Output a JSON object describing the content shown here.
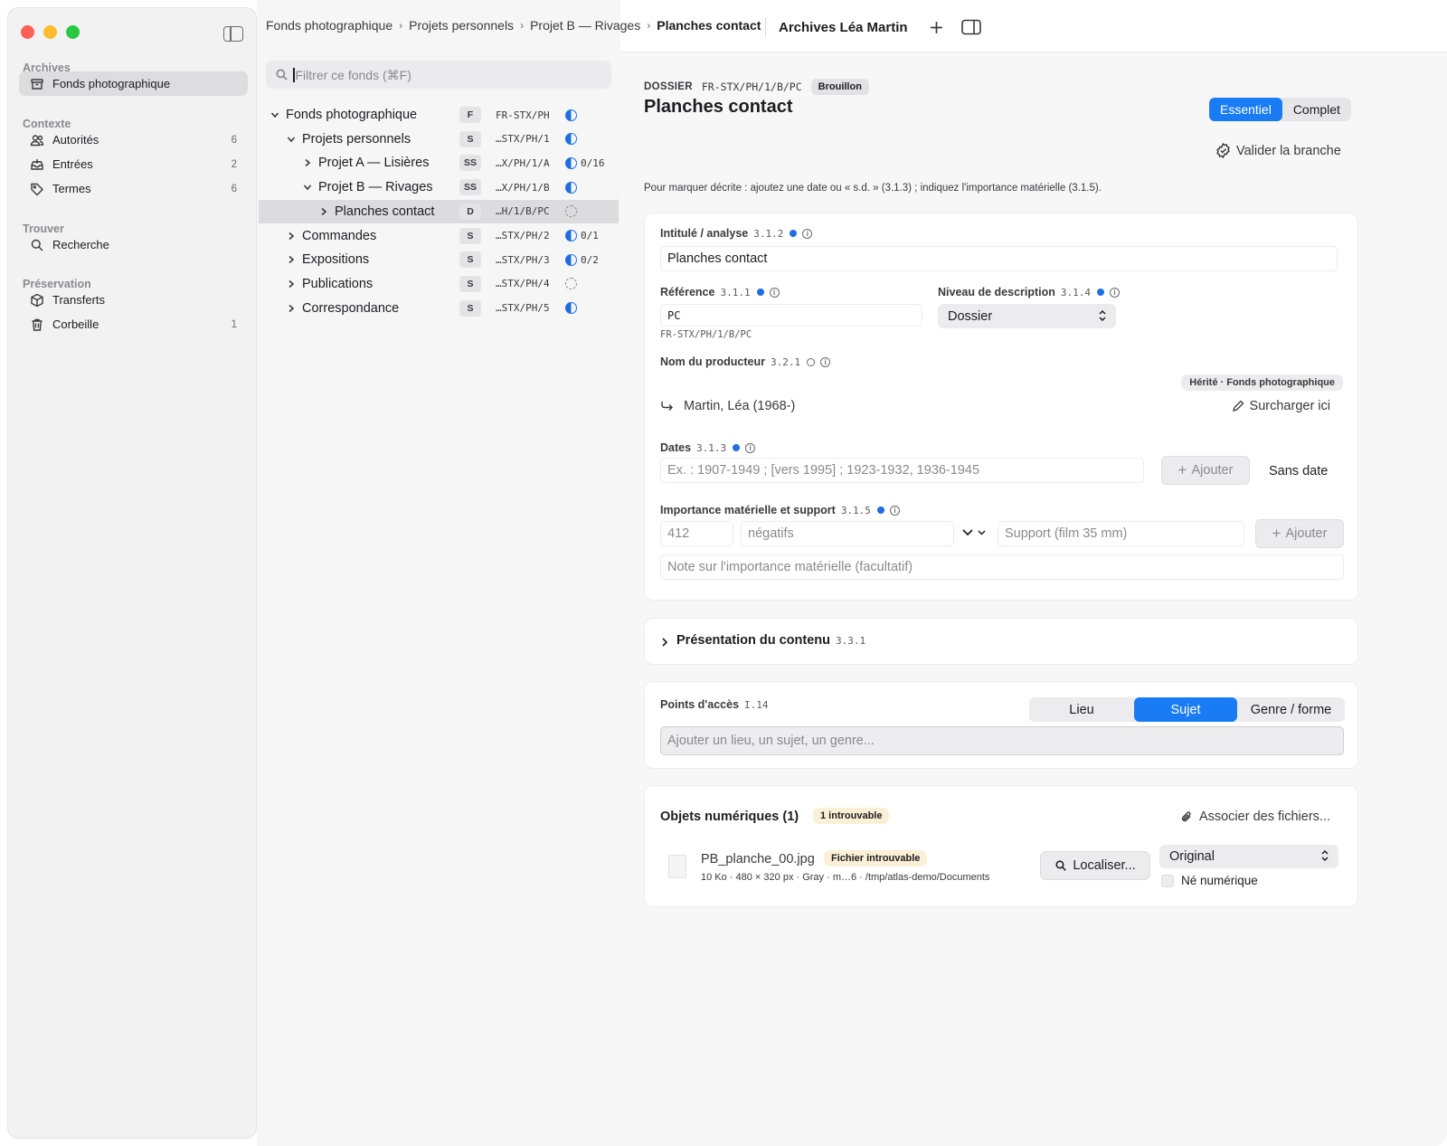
{
  "sidebar": {
    "sections": [
      {
        "title": "Archives",
        "items": [
          {
            "label": "Fonds photographique",
            "count": "",
            "icon": "archive-box-icon",
            "active": true
          }
        ]
      },
      {
        "title": "Contexte",
        "items": [
          {
            "label": "Autorités",
            "count": "6",
            "icon": "people-icon"
          },
          {
            "label": "Entrées",
            "count": "2",
            "icon": "inbox-tray-icon"
          },
          {
            "label": "Termes",
            "count": "6",
            "icon": "tag-icon"
          }
        ]
      },
      {
        "title": "Trouver",
        "items": [
          {
            "label": "Recherche",
            "count": "",
            "icon": "search-icon"
          }
        ]
      },
      {
        "title": "Préservation",
        "items": [
          {
            "label": "Transferts",
            "count": "",
            "icon": "cube-icon"
          },
          {
            "label": "Corbeille",
            "count": "1",
            "icon": "trash-icon"
          }
        ]
      }
    ]
  },
  "breadcrumbs": [
    "Fonds photographique",
    "Projets personnels",
    "Projet B — Rivages",
    "Planches contact"
  ],
  "archive_title": "Archives Léa Martin",
  "filter": {
    "placeholder": "Filtrer ce fonds (⌘F)"
  },
  "tree": [
    {
      "label": "Fonds photographique",
      "level": "F",
      "ref": "FR-STX/PH",
      "status": "partial",
      "count": "",
      "depth": 0,
      "expanded": true
    },
    {
      "label": "Projets personnels",
      "level": "S",
      "ref": "…STX/PH/1",
      "status": "partial",
      "count": "",
      "depth": 1,
      "expanded": true
    },
    {
      "label": "Projet A — Lisières",
      "level": "SS",
      "ref": "…X/PH/1/A",
      "status": "partial",
      "count": "0/16",
      "depth": 2,
      "expanded": false
    },
    {
      "label": "Projet B — Rivages",
      "level": "SS",
      "ref": "…X/PH/1/B",
      "status": "partial",
      "count": "",
      "depth": 2,
      "expanded": true
    },
    {
      "label": "Planches contact",
      "level": "D",
      "ref": "…H/1/B/PC",
      "status": "draft",
      "count": "",
      "depth": 3,
      "expanded": false,
      "selected": true
    },
    {
      "label": "Commandes",
      "level": "S",
      "ref": "…STX/PH/2",
      "status": "partial",
      "count": "0/1",
      "depth": 1,
      "expanded": false
    },
    {
      "label": "Expositions",
      "level": "S",
      "ref": "…STX/PH/3",
      "status": "partial",
      "count": "0/2",
      "depth": 1,
      "expanded": false
    },
    {
      "label": "Publications",
      "level": "S",
      "ref": "…STX/PH/4",
      "status": "draft",
      "count": "",
      "depth": 1,
      "expanded": false
    },
    {
      "label": "Correspondance",
      "level": "S",
      "ref": "…STX/PH/5",
      "status": "partial",
      "count": "",
      "depth": 1,
      "expanded": false
    }
  ],
  "record": {
    "kind": "DOSSIER",
    "ref": "FR-STX/PH/1/B/PC",
    "status_badge": "Brouillon",
    "title": "Planches contact",
    "mode_tabs": [
      "Essentiel",
      "Complet"
    ],
    "mode_selected": "Essentiel",
    "validate_label": "Valider la branche",
    "hint": "Pour marquer décrite : ajoutez une date ou « s.d. » (3.1.3) ; indiquez l'importance matérielle (3.1.5)."
  },
  "fields": {
    "intitule": {
      "label": "Intitulé / analyse",
      "code": "3.1.2",
      "value": "Planches contact"
    },
    "reference": {
      "label": "Référence",
      "code": "3.1.1",
      "value": "PC",
      "full": "FR-STX/PH/1/B/PC"
    },
    "niveau": {
      "label": "Niveau de description",
      "code": "3.1.4",
      "value": "Dossier"
    },
    "producteur": {
      "label": "Nom du producteur",
      "code": "3.2.1",
      "inherited_badge": "Hérité · Fonds photographique",
      "value": "Martin, Léa (1968-)",
      "override_label": "Surcharger ici"
    },
    "dates": {
      "label": "Dates",
      "code": "3.1.3",
      "placeholder": "Ex. : 1907-1949 ; [vers 1995] ; 1923-1932, 1936-1945",
      "add_label": "Ajouter",
      "no_date_label": "Sans date"
    },
    "importance": {
      "label": "Importance matérielle et support",
      "code": "3.1.5",
      "quantity": "412",
      "unit": "négatifs",
      "support_placeholder": "Support (film 35 mm)",
      "add_label": "Ajouter",
      "note_placeholder": "Note sur l'importance matérielle (facultatif)"
    }
  },
  "presentation": {
    "label": "Présentation du contenu",
    "code": "3.3.1"
  },
  "access": {
    "label": "Points d'accès",
    "code": "I.14",
    "tabs": [
      "Lieu",
      "Sujet",
      "Genre / forme"
    ],
    "selected": "Sujet",
    "placeholder": "Ajouter un lieu, un sujet, un genre..."
  },
  "digital": {
    "title": "Objets numériques (1)",
    "badge": "1 introuvable",
    "associate_label": "Associer des fichiers...",
    "file": {
      "name": "PB_planche_00.jpg",
      "badge": "Fichier introuvable",
      "meta": "10 Ko · 480 × 320 px · Gray · m…6 · /tmp/atlas-demo/Documents",
      "locate_label": "Localiser...",
      "role": "Original",
      "born_digital_label": "Né numérique"
    }
  },
  "colors": {
    "accent": "#1a7cf5",
    "status_blue": "#1f6fe0",
    "warn_bg": "#fbf0d6"
  }
}
